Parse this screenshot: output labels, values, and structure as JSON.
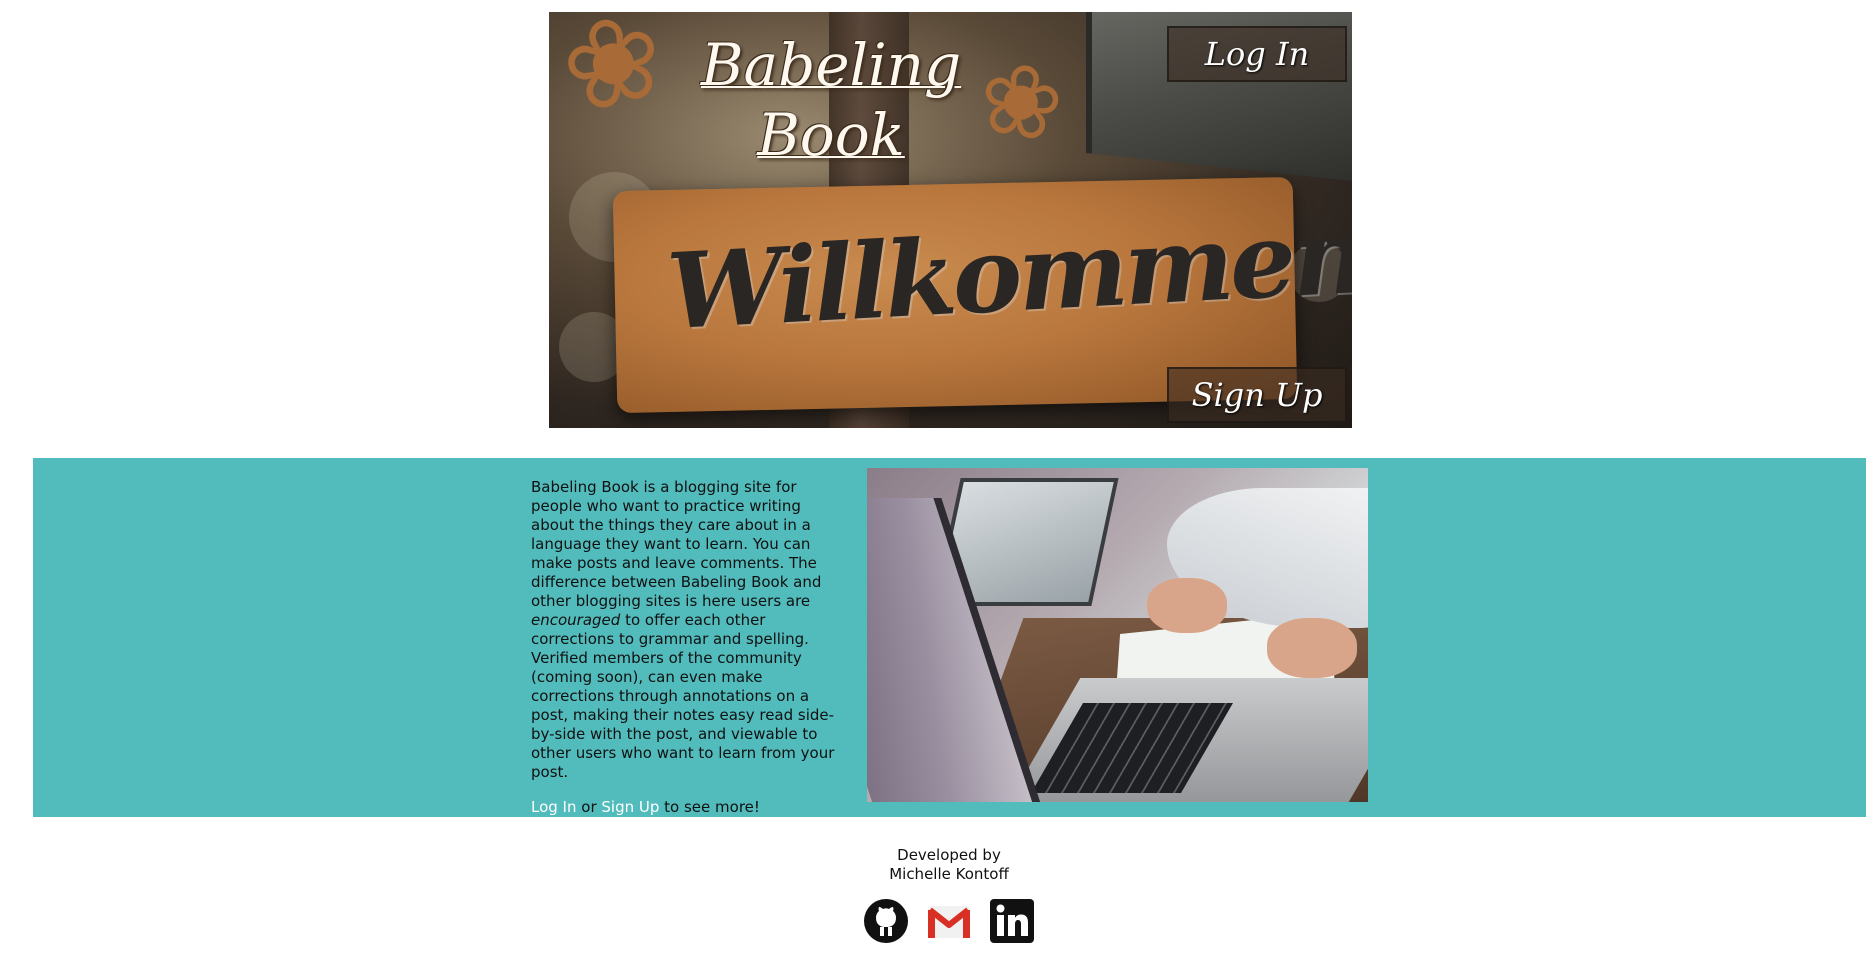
{
  "hero": {
    "brand_line1": "Babeling",
    "brand_line2": "Book",
    "sign_text": "Willkommen",
    "login_label": "Log In",
    "signup_label": "Sign Up"
  },
  "about": {
    "text_before": "Babeling Book is a blogging site for people who want to practice writing about the things they care about in a language they want to learn. You can make posts and leave comments. The difference between Babeling Book and other blogging sites is here users are ",
    "text_emphasis": "encouraged",
    "text_after": " to offer each other corrections to grammar and spelling. Verified members of the community (coming soon), can even make corrections through annotations on a post, making their notes easy read side-by-side with the post, and viewable to other users who want to learn from your post.",
    "cta_login": "Log In",
    "cta_or": " or ",
    "cta_signup": "Sign Up",
    "cta_tail": " to see more!"
  },
  "footer": {
    "developed_by": "Developed by",
    "developer": "Michelle Kontoff",
    "icons": [
      "github-icon",
      "gmail-icon",
      "linkedin-icon"
    ]
  },
  "colors": {
    "band": "#52bbbc",
    "link": "#ffffff"
  }
}
